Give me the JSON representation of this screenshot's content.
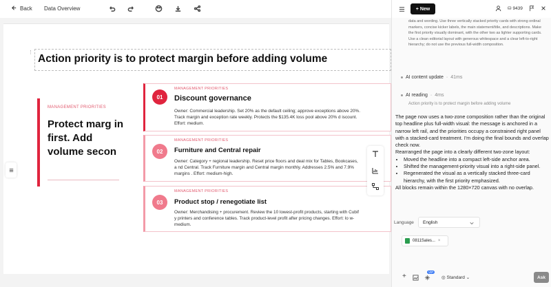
{
  "toolbar": {
    "back_label": "Back",
    "doc_title": "Data Overview",
    "icons": [
      "arrow-left-icon",
      "undo-icon",
      "redo-icon",
      "palette-icon",
      "download-icon",
      "share-icon"
    ]
  },
  "slide": {
    "headline": "Action priority is to protect margin before adding volume",
    "left": {
      "kicker": "MANAGEMENT PRIORITIES",
      "title": "Protect marg in first. Add volume secon"
    },
    "cards": [
      {
        "number": "01",
        "kicker": "MANAGEMENT PRIORITIES",
        "title": "Discount governance",
        "desc": "Owner: Commercial leadership. Set 20% as the default ceiling; approve exceptions above 20%. Track margin and exception rate weekly. Protects the $135.4K loss pool above 20% d iscount. Effort: medium."
      },
      {
        "number": "02",
        "kicker": "MANAGEMENT PRIORITIES",
        "title": "Furniture and Central repair",
        "desc": "Owner: Category + regional leadership. Reset price floors and deal mix for Tables, Bookcases, a nd Central. Track Furniture margin and Central margin monthly. Addresses 2.5% and 7.9% margins . Effort: medium-high."
      },
      {
        "number": "03",
        "kicker": "MANAGEMENT PRIORITIES",
        "title": "Product stop / renegotiate list",
        "desc": "Owner: Merchandising + procurement. Review the 10 lowest-profit products, starting with Cubif y printers and conference tables. Track product-level profit after pricing changes. Effort: lo w-medium."
      }
    ],
    "colors": {
      "accent": "#e0243e",
      "accent_light": "#f39aa8"
    }
  },
  "panel": {
    "new_label": "New",
    "credits": "9439",
    "prompt_excerpt": "data and wording. Use three vertically stacked priority cards with strong ordinal markers, concise kicker labels, the main statement/title, and descriptions. Make the first priority visually dominant, with the other two as lighter supporting cards. Use a clean editorial layout with generous whitespace and a clear left-to-right hierarchy; do not use the previous full-width composition.",
    "steps": [
      {
        "label": "AI content update",
        "time": "41ms"
      },
      {
        "label": "AI reading",
        "time": "4ms",
        "sub": "Action priority is to protect margin before adding volume"
      }
    ],
    "response_intro": "The page now uses a two-zone composition rather than the original top headline plus full-width visual: the message is anchored in a narrow left rail, and the priorities occupy a constrained right panel with a stacked-card treatment. I'm doing the final bounds and overlap check now.",
    "response_rearranged": "Rearranged the page into a clearly different two-zone layout:",
    "response_bullets": [
      "Moved the headline into a compact left-side anchor area.",
      "Shifted the management-priority visual into a right-side panel.",
      "Regenerated the visual as a vertically stacked three-card hierarchy, with the first priority emphasized."
    ],
    "response_outro": "All blocks remain within the 1280×720 canvas with no overlap.",
    "language_label": "Language",
    "language_value": "English",
    "file_name": "0811Sales...",
    "vip_label": "VIP",
    "mode_label": "Standard",
    "ask_label": "Ask"
  }
}
